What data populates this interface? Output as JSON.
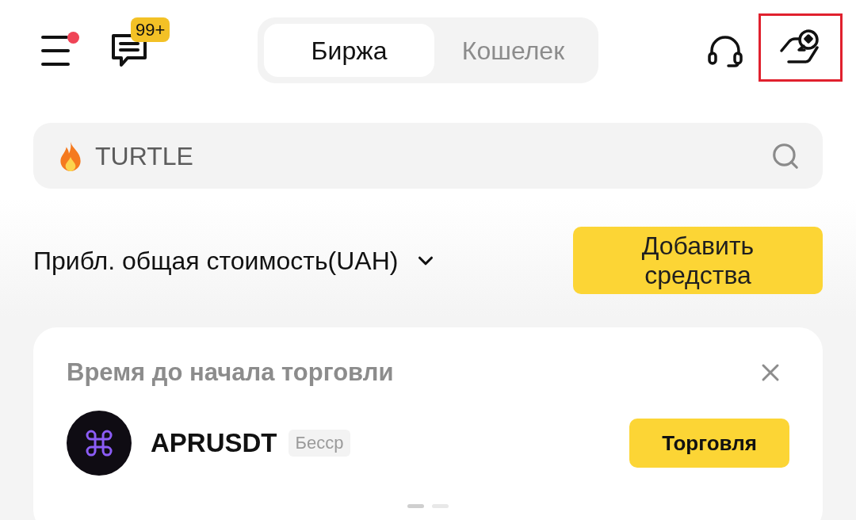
{
  "header": {
    "menu": {
      "has_notification": true
    },
    "messages": {
      "badge": "99+"
    },
    "tabs": [
      {
        "label": "Биржа",
        "selected": true
      },
      {
        "label": "Кошелек",
        "selected": false
      }
    ],
    "reward_button": {
      "highlighted": true
    }
  },
  "search": {
    "placeholder": "TURTLE"
  },
  "balance": {
    "label": "Прибл. общая стоимость(UAH)",
    "add_funds_button": "Добавить средства"
  },
  "card": {
    "title": "Время до начала торговли",
    "pair": "APRUSDT",
    "tag": "Бесср",
    "trade_button": "Торговля",
    "pages": [
      {
        "selected": true
      },
      {
        "selected": false
      }
    ]
  }
}
